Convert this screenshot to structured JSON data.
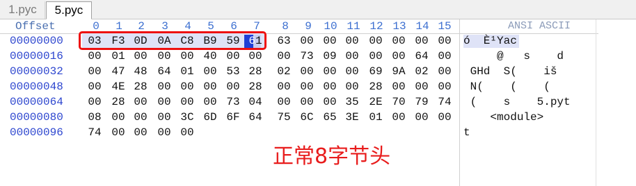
{
  "tabs": [
    {
      "label": "1.pyc",
      "active": false
    },
    {
      "label": "5.pyc",
      "active": true
    }
  ],
  "header": {
    "offset_label": "Offset",
    "columns": [
      "0",
      "1",
      "2",
      "3",
      "4",
      "5",
      "6",
      "7",
      "8",
      "9",
      "10",
      "11",
      "12",
      "13",
      "14",
      "15"
    ],
    "ascii_label": "ANSI ASCII"
  },
  "rows": [
    {
      "offset": "00000000",
      "bytes": [
        "03",
        "F3",
        "0D",
        "0A",
        "C8",
        "B9",
        "59",
        "61",
        "63",
        "00",
        "00",
        "00",
        "00",
        "00",
        "00",
        "00"
      ],
      "ascii": "ó  È¹Yac"
    },
    {
      "offset": "00000016",
      "bytes": [
        "00",
        "01",
        "00",
        "00",
        "00",
        "40",
        "00",
        "00",
        "00",
        "73",
        "09",
        "00",
        "00",
        "00",
        "64",
        "00"
      ],
      "ascii": "     @   s    d"
    },
    {
      "offset": "00000032",
      "bytes": [
        "00",
        "47",
        "48",
        "64",
        "01",
        "00",
        "53",
        "28",
        "02",
        "00",
        "00",
        "00",
        "69",
        "9A",
        "02",
        "00"
      ],
      "ascii": " GHd  S(    iš"
    },
    {
      "offset": "00000048",
      "bytes": [
        "00",
        "4E",
        "28",
        "00",
        "00",
        "00",
        "00",
        "28",
        "00",
        "00",
        "00",
        "00",
        "28",
        "00",
        "00",
        "00"
      ],
      "ascii": " N(    (    ("
    },
    {
      "offset": "00000064",
      "bytes": [
        "00",
        "28",
        "00",
        "00",
        "00",
        "00",
        "73",
        "04",
        "00",
        "00",
        "00",
        "35",
        "2E",
        "70",
        "79",
        "74"
      ],
      "ascii": " (    s    5.pyt"
    },
    {
      "offset": "00000080",
      "bytes": [
        "08",
        "00",
        "00",
        "00",
        "3C",
        "6D",
        "6F",
        "64",
        "75",
        "6C",
        "65",
        "3E",
        "01",
        "00",
        "00",
        "00"
      ],
      "ascii": "    <module>"
    },
    {
      "offset": "00000096",
      "bytes": [
        "74",
        "00",
        "00",
        "00",
        "00"
      ],
      "ascii": "t"
    }
  ],
  "annotation": {
    "text": "正常8字节头",
    "color": "#e81c1c"
  },
  "colors": {
    "offset": "#2d46cf",
    "column_header": "#3c6fd0",
    "highlight": "#dfe3f7",
    "cursor": "#1f3fd6",
    "annotation_box": "#ee1111"
  }
}
